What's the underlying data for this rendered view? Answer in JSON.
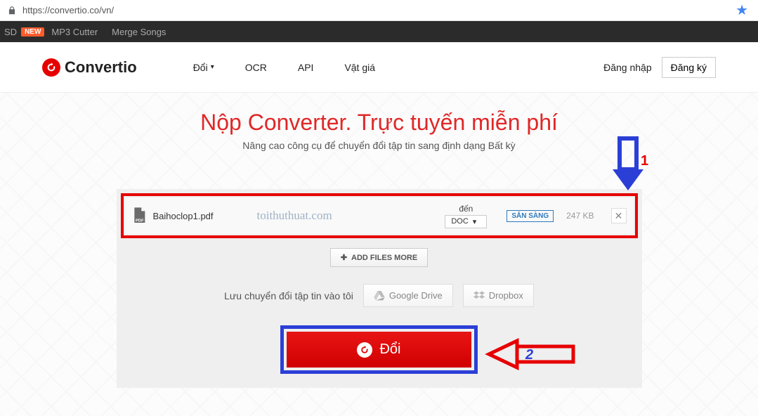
{
  "browser": {
    "url": "https://convertio.co/vn/"
  },
  "topbar": {
    "sd": "SD",
    "badge_new": "NEW",
    "mp3_cutter": "MP3 Cutter",
    "merge_songs": "Merge Songs"
  },
  "header": {
    "brand": "Convertio",
    "nav": {
      "doi": "Đổi",
      "ocr": "OCR",
      "api": "API",
      "vatgia": "Vật giá"
    },
    "login": "Đăng nhập",
    "signup": "Đăng ký"
  },
  "hero": {
    "title": "Nộp Converter. Trực tuyến miễn phí",
    "subtitle": "Nâng cao công cụ để chuyển đổi tập tin sang định dạng Bất kỳ"
  },
  "file": {
    "name": "Baihoclop1.pdf",
    "watermark": "toithuthuat.com",
    "to_label": "đến",
    "target_format": "DOC",
    "ready_badge": "SẴN SÀNG",
    "size": "247 KB"
  },
  "add_more": "ADD FILES MORE",
  "save_row": {
    "text": "Lưu chuyển đổi tập tin vào tôi",
    "gdrive": "Google Drive",
    "dropbox": "Dropbox"
  },
  "convert_label": "Đổi",
  "annotations": {
    "one": "1",
    "two": "2"
  }
}
